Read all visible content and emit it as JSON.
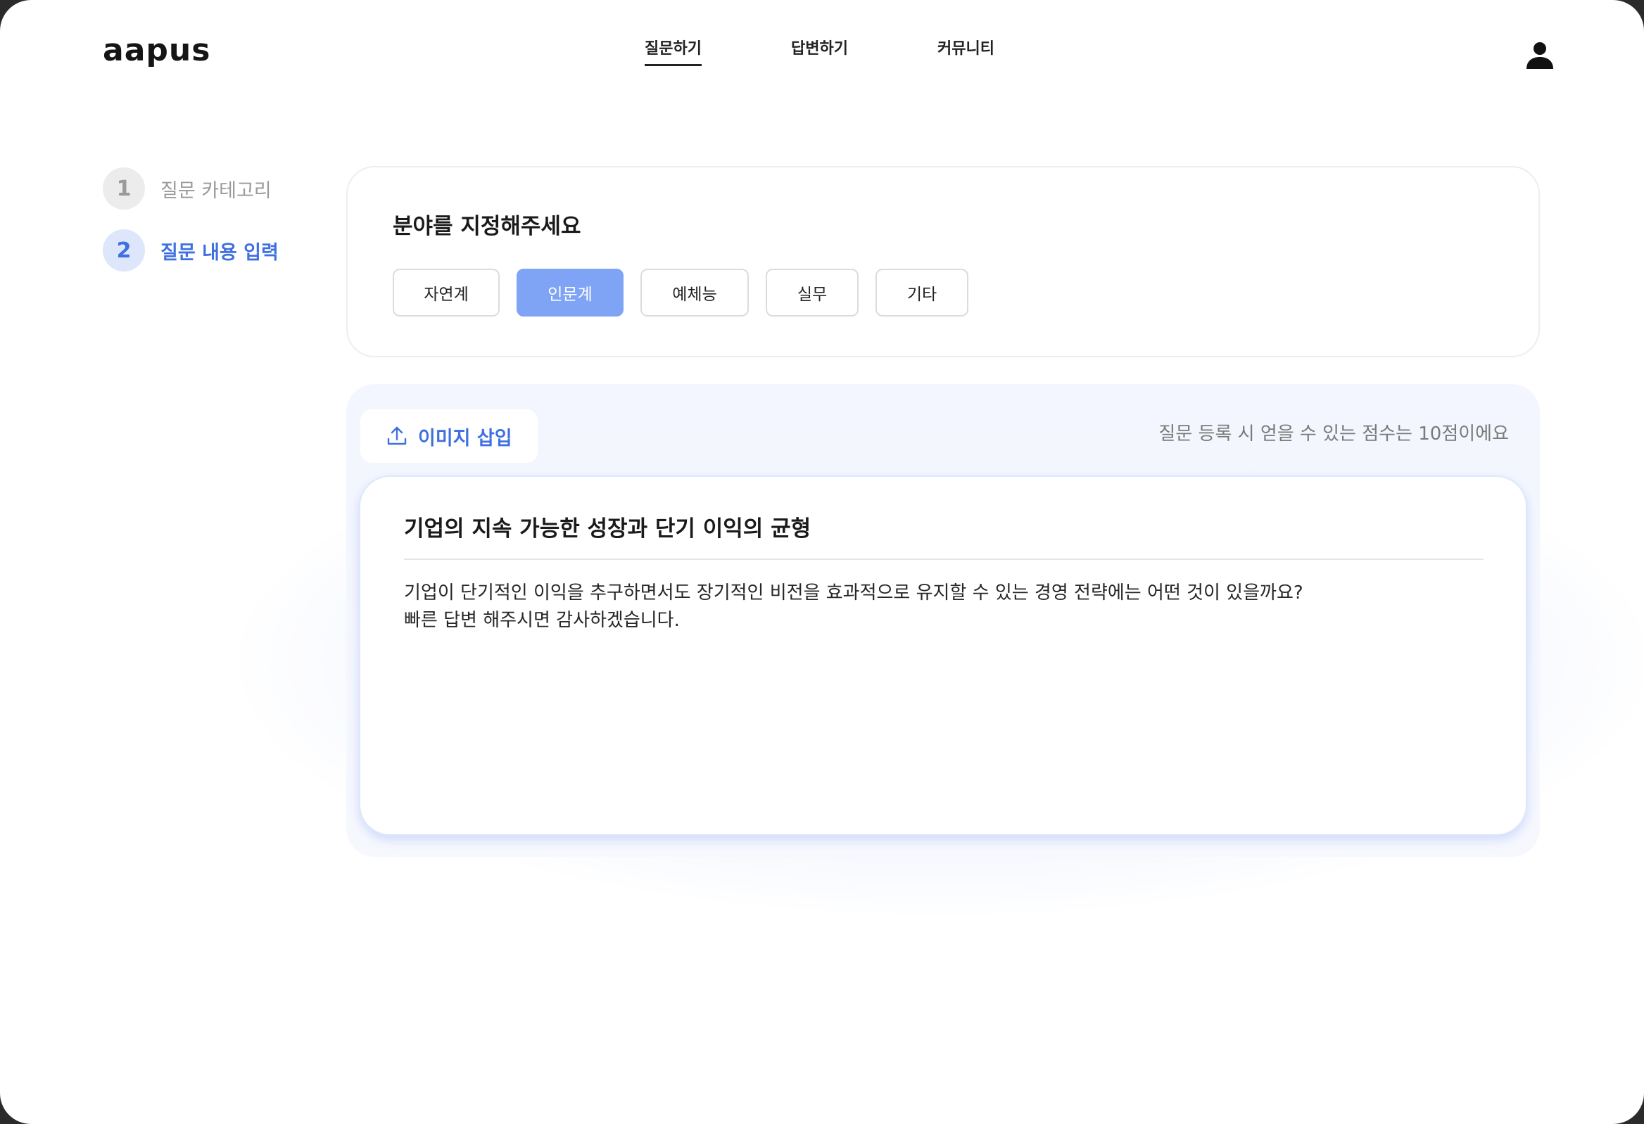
{
  "app": {
    "logo": "aapus"
  },
  "nav": {
    "items": [
      {
        "label": "질문하기",
        "active": true
      },
      {
        "label": "답변하기",
        "active": false
      },
      {
        "label": "커뮤니티",
        "active": false
      }
    ],
    "user_icon": "user-icon"
  },
  "steps": [
    {
      "number": "1",
      "label": "질문 카테고리",
      "active": false
    },
    {
      "number": "2",
      "label": "질문 내용 입력",
      "active": true
    }
  ],
  "category": {
    "title": "분야를 지정해주세요",
    "options": [
      "자연계",
      "인문계",
      "예체능",
      "실무",
      "기타"
    ],
    "selected": "인문계"
  },
  "editor": {
    "image_insert_label": "이미지 삽입",
    "image_insert_icon": "upload-icon",
    "points_note": "질문 등록 시 얻을 수 있는 점수는 10점이에요",
    "question_title": "기업의 지속 가능한 성장과 단기 이익의 균형",
    "question_body_lines": [
      "기업이 단기적인 이익을 추구하면서도 장기적인 비전을 효과적으로 유지할 수 있는 경영 전략에는 어떤 것이 있을까요?",
      "빠른 답변 해주시면 감사하겠습니다."
    ]
  },
  "colors": {
    "accent": "#3f70e0",
    "selected_chip": "#7fa4f5",
    "panel_bg": "#f3f6fe"
  }
}
